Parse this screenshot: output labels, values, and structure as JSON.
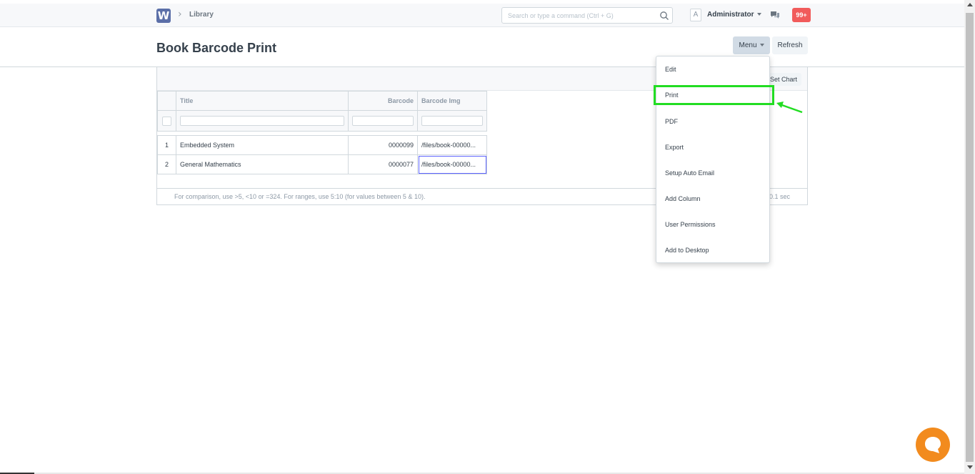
{
  "navbar": {
    "logo_letter": "W",
    "breadcrumb": "Library",
    "search_placeholder": "Search or type a command (Ctrl + G)",
    "avatar_letter": "A",
    "user_name": "Administrator",
    "notification_count": "99+"
  },
  "page": {
    "title": "Book Barcode Print",
    "menu_label": "Menu",
    "refresh_label": "Refresh",
    "set_chart_label": "Set Chart"
  },
  "table": {
    "columns": [
      "Title",
      "Barcode",
      "Barcode Img"
    ],
    "rows": [
      {
        "num": "1",
        "title": "Embedded System",
        "barcode": "0000099",
        "barcode_img": "/files/book-00000..."
      },
      {
        "num": "2",
        "title": "General Mathematics",
        "barcode": "0000077",
        "barcode_img": "/files/book-00000..."
      }
    ]
  },
  "footer": {
    "note": "For comparison, use >5, <10 or =324. For ranges, use 5:10 (for values between 5 & 10).",
    "time": "0.1 sec"
  },
  "menu_items": [
    "Edit",
    "Print",
    "PDF",
    "Export",
    "Setup Auto Email",
    "Add Column",
    "User Permissions",
    "Add to Desktop"
  ],
  "colors": {
    "highlight": "#22dd22",
    "notification": "#f15b5b",
    "logo": "#5b6fa8",
    "chat_bubble": "#f28b1e"
  }
}
